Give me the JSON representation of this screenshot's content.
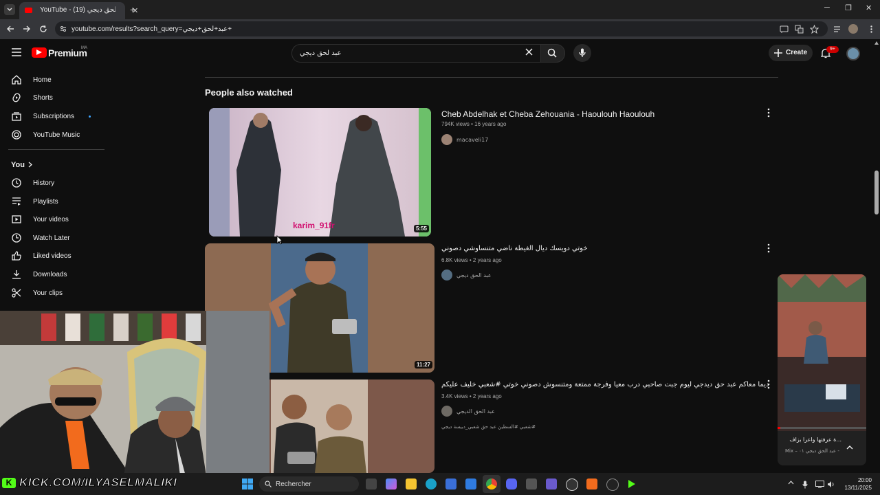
{
  "browser": {
    "tab_title": "YouTube - عبد لحق ديجي (19)",
    "url": "youtube.com/results?search_query=عبد+لحق+ديجي+"
  },
  "header": {
    "brand": "Premium",
    "region": "MA",
    "search_value": "عبد لحق ديجي",
    "create_label": "Create",
    "notification_count": "9+"
  },
  "sidebar": {
    "items": [
      {
        "label": "Home",
        "icon": "home-icon"
      },
      {
        "label": "Shorts",
        "icon": "shorts-icon"
      },
      {
        "label": "Subscriptions",
        "icon": "subscriptions-icon"
      },
      {
        "label": "YouTube Music",
        "icon": "youtube-music-icon"
      }
    ],
    "you_label": "You",
    "you_items": [
      {
        "label": "History",
        "icon": "history-icon"
      },
      {
        "label": "Playlists",
        "icon": "playlists-icon"
      },
      {
        "label": "Your videos",
        "icon": "your-videos-icon"
      },
      {
        "label": "Watch Later",
        "icon": "watch-later-icon"
      },
      {
        "label": "Liked videos",
        "icon": "liked-videos-icon"
      },
      {
        "label": "Downloads",
        "icon": "downloads-icon"
      },
      {
        "label": "Your clips",
        "icon": "clips-icon"
      }
    ]
  },
  "results": {
    "section_title": "People also watched",
    "videos": [
      {
        "title": "Cheb Abdelhak et Cheba Zehouania - Haoulouh Haoulouh",
        "meta": "794K views • 16 years ago",
        "channel": "macaveli17",
        "duration": "5:55",
        "watermark": "karim_91fr"
      },
      {
        "title": "خوتي دويسك ديال الغيطة ناضي متنساوشي دصوني",
        "meta": "6.8K views • 2 years ago",
        "channel": "عبد الحق ديجي",
        "duration": "11:27"
      },
      {
        "title": "ديما معاكم عبد حق ديدجي ليوم جبت صاحبي درب معيا وفرجة ممتعة ومتنسوش دصوني خوتي #شعبي خليف عليكم",
        "meta": "3.4K views • 2 years ago",
        "channel": "عبد الحق الديجي",
        "hashtags": "#شعبي #السطين عبد حق شعبي_دبيسة ديجي"
      }
    ]
  },
  "miniplayer": {
    "title": "...ة عرفتها واعرا بزاف",
    "subtitle": "Mix – عبد الحق ديجي ٠١ -"
  },
  "overlay": {
    "kick_handle": "KICK.COM/ILYASELMALIKI"
  },
  "taskbar": {
    "search_label": "Rechercher",
    "time": "20:00",
    "date": "13/11/2025"
  },
  "colors": {
    "youtube_red": "#ff0000",
    "kick_green": "#53fc18",
    "background": "#0f0f0f"
  }
}
